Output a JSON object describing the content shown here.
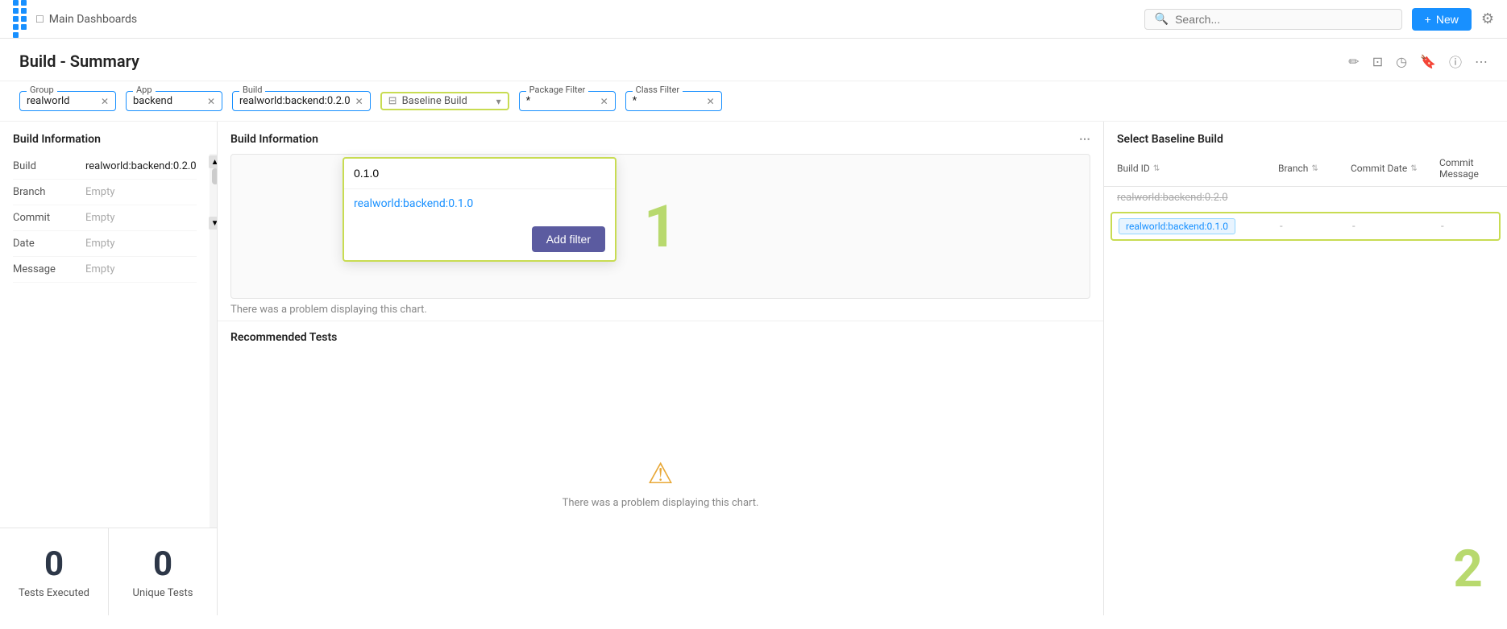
{
  "nav": {
    "logo_dots": 9,
    "breadcrumb_icon": "☰",
    "breadcrumb_label": "Main Dashboards",
    "search_placeholder": "Search...",
    "new_btn_label": "New",
    "settings_icon": "⚙"
  },
  "page": {
    "title": "Build - Summary",
    "actions": {
      "edit": "✏",
      "share": "⊡",
      "history": "◷",
      "bookmark": "🔖",
      "info": "ⓘ",
      "more": "⋯"
    }
  },
  "filters": {
    "group_label": "Group",
    "group_value": "realworld",
    "app_label": "App",
    "app_value": "backend",
    "build_label": "Build",
    "build_value": "realworld:backend:0.2.0",
    "baseline_label": "Baseline Build",
    "baseline_value": "Baseline Build",
    "package_filter_label": "Package Filter",
    "package_filter_value": "*",
    "class_filter_label": "Class Filter",
    "class_filter_value": "*"
  },
  "build_info": {
    "panel_title": "Build Information",
    "rows": [
      {
        "key": "Build",
        "value": "realworld:backend:0.2.0",
        "filled": true
      },
      {
        "key": "Branch",
        "value": "Empty",
        "filled": false
      },
      {
        "key": "Commit",
        "value": "Empty",
        "filled": false
      },
      {
        "key": "Date",
        "value": "Empty",
        "filled": false
      },
      {
        "key": "Message",
        "value": "Empty",
        "filled": false
      }
    ]
  },
  "stats": {
    "tests_executed": "0",
    "tests_executed_label": "Tests Executed",
    "unique_tests": "0",
    "unique_tests_label": "Unique Tests"
  },
  "middle_panel": {
    "title": "Build Information",
    "chart_number": "1",
    "chart_error": "There was a problem displaying this chart.",
    "recommended_title": "Recommended Tests",
    "recommended_error": "There was a problem displaying this chart.",
    "more_icon": "⋯"
  },
  "dropdown": {
    "search_value": "0.1.0",
    "item_label": "realworld:backend:0.1.0",
    "add_filter_label": "Add filter"
  },
  "baseline_table": {
    "title": "Select Baseline Build",
    "col_build_id": "Build ID",
    "col_branch": "Branch",
    "col_commit_date": "Commit Date",
    "col_commit_message": "Commit Message",
    "dimmed_row": "realworld:backend:0.2.0",
    "selected_build_id": "realworld:backend:0.1.0",
    "selected_branch": "-",
    "selected_commit_date": "-",
    "selected_commit_message": "-"
  },
  "callouts": {
    "left": "1",
    "right": "2"
  }
}
